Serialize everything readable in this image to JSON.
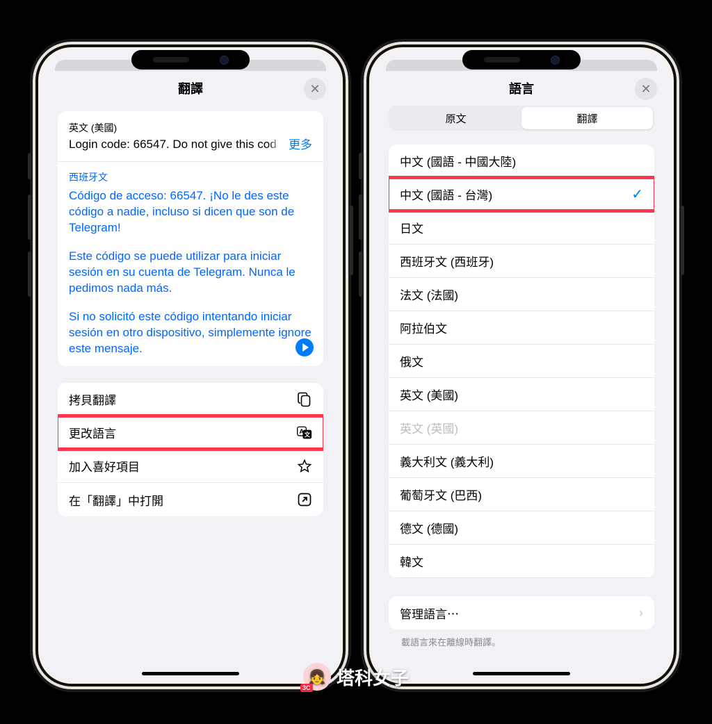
{
  "left": {
    "sheet_title": "翻譯",
    "close": "✕",
    "source_label": "英文 (美國)",
    "source_text": "Login code: 66547. Do not give this cod",
    "more": "更多",
    "target_label": "西班牙文",
    "target_paragraphs": [
      "Código de acceso: 66547. ¡No le des este código a nadie, incluso si dicen que son de Telegram!",
      "Este código se puede utilizar para iniciar sesión en su cuenta de Telegram. Nunca le pedimos nada más.",
      "Si no solicitó este código intentando iniciar sesión en otro dispositivo, simplemente ignore este mensaje."
    ],
    "actions": {
      "copy": "拷貝翻譯",
      "change_lang": "更改語言",
      "favorite": "加入喜好項目",
      "open_app": "在「翻譯」中打開"
    }
  },
  "right": {
    "sheet_title": "語言",
    "close": "✕",
    "segments": {
      "source": "原文",
      "target": "翻譯"
    },
    "languages": [
      {
        "label": "中文 (國語 - 中國大陸)",
        "selected": false,
        "highlighted": false
      },
      {
        "label": "中文 (國語 - 台灣)",
        "selected": true,
        "highlighted": true
      },
      {
        "label": "日文",
        "selected": false
      },
      {
        "label": "西班牙文 (西班牙)",
        "selected": false
      },
      {
        "label": "法文 (法國)",
        "selected": false
      },
      {
        "label": "阿拉伯文",
        "selected": false
      },
      {
        "label": "俄文",
        "selected": false
      },
      {
        "label": "英文 (美國)",
        "selected": false
      },
      {
        "label": "英文 (英國)",
        "selected": false,
        "disabled": true
      },
      {
        "label": "義大利文 (義大利)",
        "selected": false
      },
      {
        "label": "葡萄牙文 (巴西)",
        "selected": false
      },
      {
        "label": "德文 (德國)",
        "selected": false
      },
      {
        "label": "韓文",
        "selected": false
      }
    ],
    "manage": "管理語言⋯",
    "foot_note": "載語言來在離線時翻譯。"
  },
  "watermark": "塔科女子"
}
